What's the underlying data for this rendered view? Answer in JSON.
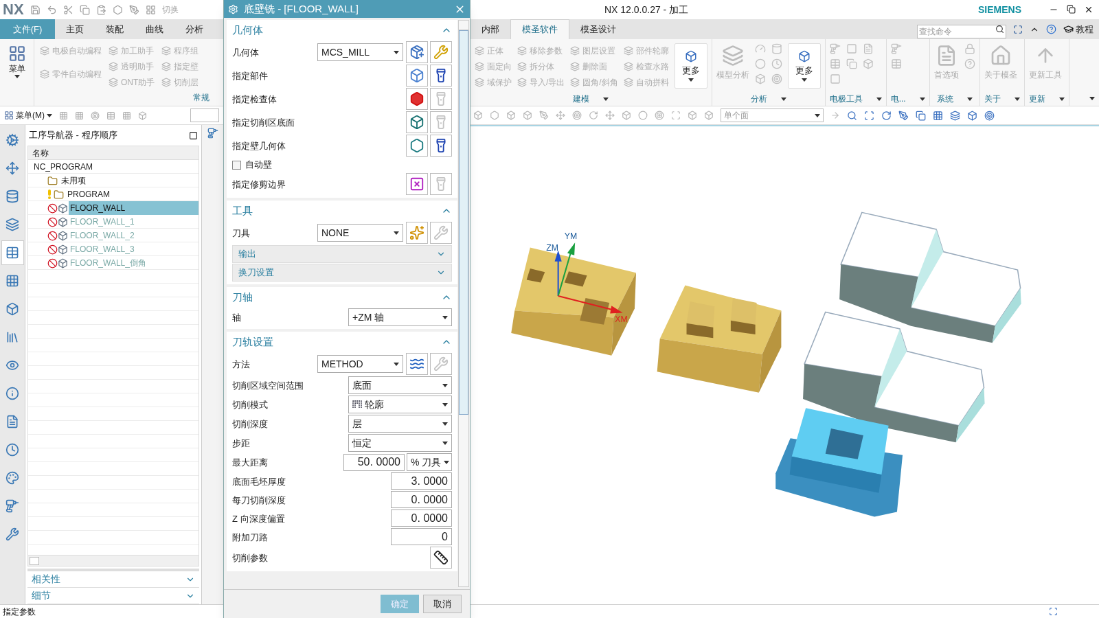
{
  "window": {
    "logo": "NX",
    "title": "NX 12.0.0.27 - 加工",
    "brand": "SIEMENS"
  },
  "quick_access": {
    "switch_label": "切换"
  },
  "ribbon": {
    "file_button": "文件(F)",
    "tabs_left": [
      {
        "label": "主页",
        "selected": false
      },
      {
        "label": "装配",
        "selected": false
      },
      {
        "label": "曲线",
        "selected": false
      },
      {
        "label": "分析",
        "selected": false
      }
    ],
    "tabs_right": [
      {
        "label": "内部",
        "selected": false
      },
      {
        "label": "模圣软件",
        "selected": true
      },
      {
        "label": "模圣设计",
        "selected": false
      }
    ],
    "search": {
      "placeholder": "查找命令"
    },
    "tutorial": "教程",
    "left_group": {
      "menu_button": "菜单",
      "label": "常规",
      "columns": [
        [
          {
            "label": "电极自动编程",
            "disabled": true
          },
          {
            "label": "零件自动编程",
            "disabled": true
          }
        ],
        [
          {
            "label": "加工助手",
            "disabled": true
          },
          {
            "label": "透明助手",
            "disabled": true
          },
          {
            "label": "ONT助手",
            "disabled": true
          }
        ],
        [
          {
            "label": "程序组",
            "disabled": true
          },
          {
            "label": "指定壁",
            "disabled": true
          },
          {
            "label": "切削层",
            "disabled": true
          }
        ]
      ]
    },
    "right_groups": [
      {
        "kind": "modeling",
        "label": "建模",
        "columns": [
          [
            {
              "label": "正体",
              "disabled": true
            },
            {
              "label": "面定向",
              "disabled": true
            },
            {
              "label": "域保护",
              "disabled": true
            }
          ],
          [
            {
              "label": "移除参数",
              "disabled": true
            },
            {
              "label": "拆分体",
              "disabled": true
            },
            {
              "label": "导入/导出",
              "disabled": true
            }
          ],
          [
            {
              "label": "图层设置",
              "disabled": true
            },
            {
              "label": "删除面",
              "disabled": true
            },
            {
              "label": "圆角/斜角",
              "disabled": true
            }
          ],
          [
            {
              "label": "部件轮廓",
              "disabled": true
            },
            {
              "label": "检查水路",
              "disabled": true
            },
            {
              "label": "自动拼料",
              "disabled": true
            }
          ]
        ],
        "more": "更多"
      },
      {
        "kind": "analysis",
        "label": "分析",
        "big": {
          "label": "模型分析",
          "disabled": true
        },
        "more": "更多"
      },
      {
        "kind": "electrode",
        "label": "电极工具"
      },
      {
        "kind": "electrode_short",
        "label": "电..."
      },
      {
        "kind": "system",
        "label": "系统",
        "big": {
          "label": "首选项",
          "disabled": true
        }
      },
      {
        "kind": "about",
        "label": "关于",
        "big": {
          "label": "关于模圣",
          "disabled": true
        }
      },
      {
        "kind": "update",
        "label": "更新",
        "big": {
          "label": "更新工具",
          "disabled": true
        }
      }
    ]
  },
  "toolbar_left": {
    "menu_label": "菜单(M)"
  },
  "toolbar_right": {
    "filter": "单个面"
  },
  "resource_tabs": [
    {
      "selected": false
    },
    {
      "selected": false
    },
    {
      "selected": false
    },
    {
      "selected": false
    },
    {
      "selected": true
    },
    {
      "selected": false
    },
    {
      "selected": false
    },
    {
      "selected": false
    },
    {
      "selected": false
    },
    {
      "selected": false
    },
    {
      "selected": false
    },
    {
      "selected": false
    },
    {
      "selected": false
    },
    {
      "selected": false
    },
    {
      "selected": false
    }
  ],
  "navigator": {
    "title": "工序导航器 - 程序顺序",
    "column": "名称",
    "tree": [
      {
        "label": "NC_PROGRAM",
        "kind": "root",
        "selected": false,
        "children": [
          {
            "label": "未用项",
            "kind": "group",
            "warning": false,
            "selected": false
          },
          {
            "label": "PROGRAM",
            "kind": "group",
            "warning": true,
            "selected": false
          },
          {
            "label": "FLOOR_WALL",
            "kind": "operation",
            "warning": false,
            "selected": true
          },
          {
            "label": "FLOOR_WALL_1",
            "kind": "operation",
            "warning": false,
            "selected": false
          },
          {
            "label": "FLOOR_WALL_2",
            "kind": "operation",
            "warning": false,
            "selected": false
          },
          {
            "label": "FLOOR_WALL_3",
            "kind": "operation",
            "warning": false,
            "selected": false
          },
          {
            "label": "FLOOR_WALL_倒角",
            "kind": "operation",
            "warning": false,
            "selected": false
          }
        ]
      }
    ],
    "sections": [
      {
        "label": "相关性",
        "expanded": false
      },
      {
        "label": "细节",
        "expanded": false
      }
    ]
  },
  "dialog": {
    "title": "底壁铣 - [FLOOR_WALL]",
    "sections": [
      {
        "title": "几何体",
        "expanded": true,
        "rows": [
          {
            "kind": "dropdown_buttons",
            "label": "几何体",
            "value": "MCS_MILL",
            "buttons": [
              {
                "kind": "new_geometry",
                "disabled": false
              },
              {
                "kind": "edit",
                "disabled": false
              }
            ]
          },
          {
            "kind": "selection",
            "label": "指定部件",
            "buttons": [
              {
                "kind": "select_part",
                "disabled": false
              },
              {
                "kind": "display",
                "disabled": false
              }
            ]
          },
          {
            "kind": "selection",
            "label": "指定检查体",
            "buttons": [
              {
                "kind": "select_check",
                "disabled": false
              },
              {
                "kind": "display",
                "disabled": true
              }
            ]
          },
          {
            "kind": "selection",
            "label": "指定切削区底面",
            "buttons": [
              {
                "kind": "select_floor",
                "disabled": false
              },
              {
                "kind": "display",
                "disabled": true
              }
            ]
          },
          {
            "kind": "selection",
            "label": "指定壁几何体",
            "buttons": [
              {
                "kind": "select_wall",
                "disabled": false
              },
              {
                "kind": "display",
                "disabled": false
              }
            ]
          },
          {
            "kind": "checkbox",
            "label": "自动壁",
            "checked": false
          },
          {
            "kind": "selection",
            "label": "指定修剪边界",
            "buttons": [
              {
                "kind": "select_trim",
                "disabled": false
              },
              {
                "kind": "display",
                "disabled": true
              }
            ]
          }
        ]
      },
      {
        "title": "工具",
        "expanded": true,
        "rows": [
          {
            "kind": "dropdown_buttons",
            "label": "刀具",
            "value": "NONE",
            "buttons": [
              {
                "kind": "new_tool",
                "disabled": false
              },
              {
                "kind": "edit_tool",
                "disabled": true
              }
            ]
          },
          {
            "kind": "subsection",
            "label": "输出",
            "expanded": false
          },
          {
            "kind": "subsection",
            "label": "换刀设置",
            "expanded": false
          }
        ]
      },
      {
        "title": "刀轴",
        "expanded": true,
        "rows": [
          {
            "kind": "dropdown",
            "label": "轴",
            "value": "+ZM 轴"
          }
        ]
      },
      {
        "title": "刀轨设置",
        "expanded": true,
        "rows": [
          {
            "kind": "dropdown_buttons",
            "label": "方法",
            "value": "METHOD",
            "buttons": [
              {
                "kind": "new_method",
                "disabled": false
              },
              {
                "kind": "edit",
                "disabled": true
              }
            ]
          },
          {
            "kind": "dropdown",
            "label": "切削区域空间范围",
            "value": "底面"
          },
          {
            "kind": "mode_dropdown",
            "label": "切削模式",
            "value": "轮廓"
          },
          {
            "kind": "dropdown",
            "label": "切削深度",
            "value": "层"
          },
          {
            "kind": "dropdown",
            "label": "步距",
            "value": "恒定"
          },
          {
            "kind": "number_unit",
            "label": "最大距离",
            "value": "50. 0000",
            "unit": "% 刀具"
          },
          {
            "kind": "number",
            "label": "底面毛坯厚度",
            "value": "3. 0000"
          },
          {
            "kind": "number",
            "label": "每刀切削深度",
            "value": "0. 0000"
          },
          {
            "kind": "number",
            "label": "Z 向深度偏置",
            "value": "0. 0000"
          },
          {
            "kind": "number",
            "label": "附加刀路",
            "value": "0"
          },
          {
            "kind": "selection",
            "label": "切削参数",
            "buttons": [
              {
                "kind": "cut_params",
                "disabled": false
              }
            ]
          }
        ]
      }
    ],
    "buttons": [
      {
        "label": "确定",
        "kind": "primary",
        "disabled": true
      },
      {
        "label": "取消",
        "kind": "secondary",
        "disabled": false
      }
    ]
  },
  "viewport": {
    "axes": [
      {
        "label": "ZM"
      },
      {
        "label": "YM"
      },
      {
        "label": "XM"
      }
    ]
  },
  "status_bar": {
    "message": "指定参数"
  }
}
